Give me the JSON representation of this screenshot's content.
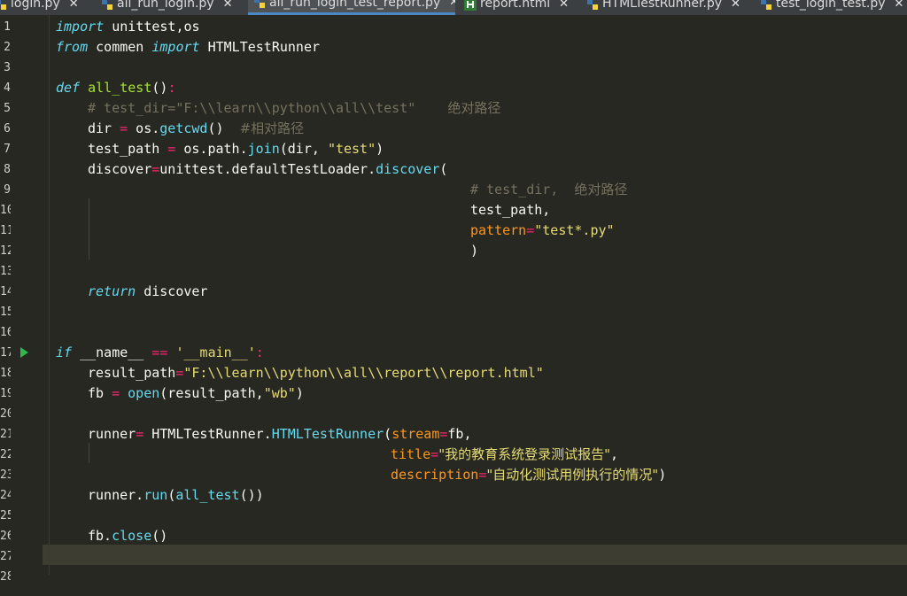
{
  "tabs": [
    {
      "label": "login.py",
      "icon": "python-file-icon"
    },
    {
      "label": "all_run_login.py",
      "icon": "python-file-icon"
    },
    {
      "label": "all_run_login_test_report.py",
      "icon": "python-file-icon",
      "active": true
    },
    {
      "label": "report.html",
      "icon": "html-file-icon"
    },
    {
      "label": "HTMLTestRunner.py",
      "icon": "python-file-icon"
    },
    {
      "label": "test_login_test.py",
      "icon": "python-file-icon"
    }
  ],
  "close_glyph": "✕",
  "line_numbers": [
    "1",
    "2",
    "3",
    "4",
    "5",
    "6",
    "7",
    "8",
    "9",
    "10",
    "11",
    "12",
    "13",
    "14",
    "15",
    "16",
    "17",
    "18",
    "19",
    "20",
    "21",
    "22",
    "23",
    "24",
    "25",
    "26",
    "27",
    "28"
  ],
  "code": {
    "l1": {
      "kw": "import",
      "rest": " unittest,os"
    },
    "l2": {
      "kw1": "from",
      "mid": " commen ",
      "kw2": "import",
      "rest": " HTMLTestRunner"
    },
    "l4": {
      "kw": "def",
      "name": "all_test",
      "paren": "()",
      "colon": ":"
    },
    "l5": {
      "comment": "# test_dir=\"F:\\\\learn\\\\python\\\\all\\\\test\"",
      "comment_cn": "绝对路径"
    },
    "l6": {
      "a": "dir ",
      "eq": "=",
      "b": " os.",
      "fn": "getcwd",
      "c": "()  ",
      "comment": "#相对路径"
    },
    "l7": {
      "a": "test_path ",
      "eq": "=",
      "b": " os.path.",
      "fn": "join",
      "c": "(dir, ",
      "s": "\"test\"",
      "d": ")"
    },
    "l8": {
      "a": "discover",
      "eq": "=",
      "b": "unittest.defaultTestLoader.",
      "fn": "discover",
      "c": "("
    },
    "l9": {
      "comment": "# test_dir,",
      "comment_cn": "绝对路径"
    },
    "l10": {
      "a": "test_path,"
    },
    "l11": {
      "p": "pattern",
      "eq": "=",
      "s": "\"test*.py\""
    },
    "l12": {
      "a": ")"
    },
    "l14": {
      "kw": "return",
      "rest": " discover"
    },
    "l17": {
      "kw": "if",
      "a": " __name__ ",
      "eq": "==",
      "b": " ",
      "s": "'__main__'",
      "colon": ":"
    },
    "l18": {
      "a": "result_path",
      "eq": "=",
      "s": "\"F:\\\\learn\\\\python\\\\all\\\\report\\\\report.html\""
    },
    "l19": {
      "a": "fb ",
      "eq": "=",
      "b": " ",
      "fn": "open",
      "c": "(result_path,",
      "s": "\"wb\"",
      "d": ")"
    },
    "l21": {
      "a": "runner",
      "eq": "=",
      "b": " HTMLTestRunner.",
      "fn": "HTMLTestRunner",
      "c": "(",
      "p": "stream",
      "eq2": "=",
      "d": "fb,"
    },
    "l22": {
      "p": "title",
      "eq": "=",
      "s": "\"我的教育系统登录测试报告\"",
      "d": ","
    },
    "l23": {
      "p": "description",
      "eq": "=",
      "s": "\"自动化测试用例执行的情况\"",
      "d": ")"
    },
    "l24": {
      "a": "runner.",
      "fn": "run",
      "c": "(",
      "fn2": "all_test",
      "d": "())"
    },
    "l26": {
      "a": "fb.",
      "fn": "close",
      "c": "()"
    }
  }
}
